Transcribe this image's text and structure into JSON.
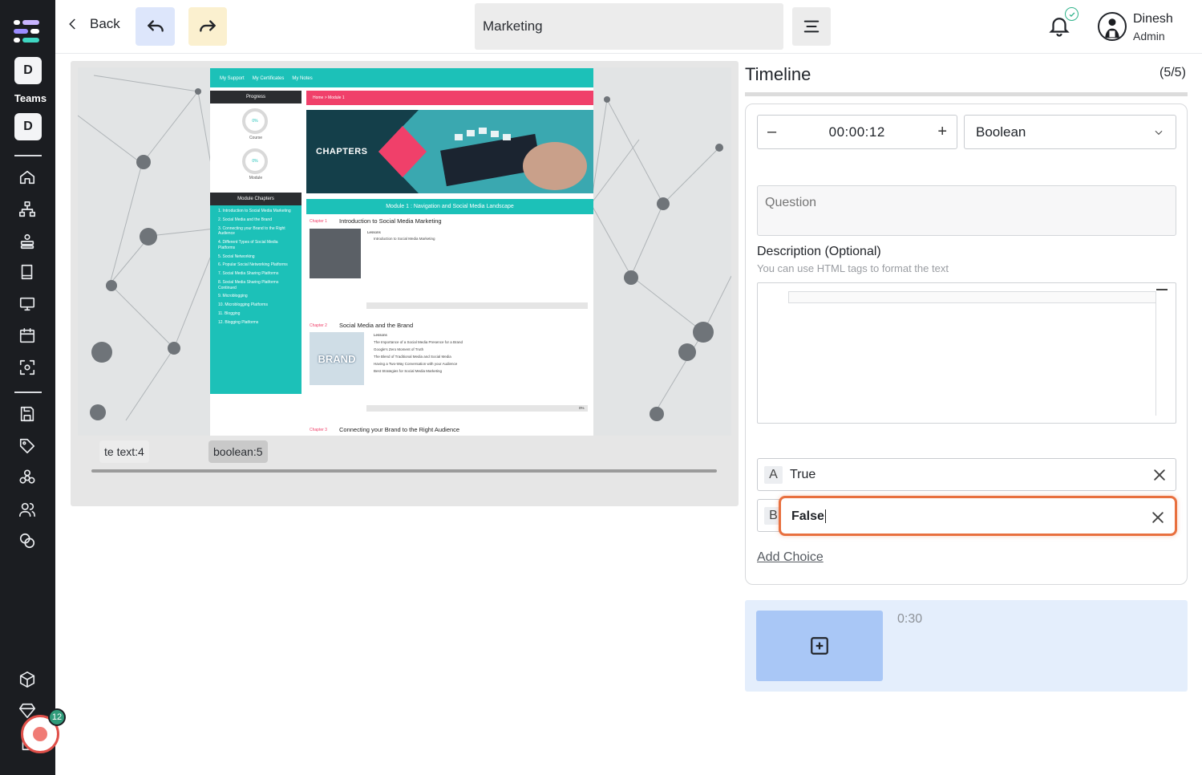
{
  "sidebar": {
    "workspace_initial": "D",
    "teams_label": "Teams",
    "team_initial": "D",
    "record_count": "12"
  },
  "topbar": {
    "back_label": "Back",
    "title_value": "Marketing",
    "user_name": "Dinesh",
    "user_role": "Admin"
  },
  "stage": {
    "tags": [
      "te text:4",
      "boolean:5"
    ]
  },
  "timeline": {
    "title": "Timeline",
    "count": "(5/5)",
    "time": "00:00:12",
    "minus": "–",
    "plus": "+",
    "type_selected": "Boolean",
    "question_placeholder": "Question",
    "description_label": "Description (Optional)",
    "description_hint": "You can use HTML tags to format the text",
    "choices": [
      {
        "letter": "A",
        "value": "True"
      },
      {
        "letter": "B",
        "value": "False"
      }
    ],
    "add_choice_label": "Add Choice",
    "duration": "0:30"
  },
  "slide": {
    "nav_links": [
      "My Support",
      "My Certificates",
      "My Notes"
    ],
    "progress_label": "Progress",
    "course_pct": "0%",
    "course_label": "Course",
    "module_pct": "0%",
    "module_label": "Module",
    "chapters_label": "Module Chapters",
    "chapter_list": [
      "1. Introduction to Social Media Marketing",
      "2. Social Media and the Brand",
      "3. Connecting your Brand to the Right Audience",
      "4. Different Types of Social Media Platforms",
      "5. Social Networking",
      "6. Popular Social Networking Platforms",
      "7. Social Media Sharing Platforms",
      "8. Social Media Sharing Platforms Continued",
      "9. Microblogging",
      "10. Microblogging Platforms",
      "11. Blogging",
      "12. Blogging Platforms"
    ],
    "breadcrumb": "Home > Module 1",
    "hero_label": "CHAPTERS",
    "module_title": "Module 1 : Navigation and Social Media Landscape",
    "chapter1_tag": "Chapter 1",
    "chapter1_title": "Introduction to Social Media Marketing",
    "chapter1_lessons_label": "Lessons",
    "chapter1_lessons": [
      "Introduction to Social Media Marketing"
    ],
    "chapter2_tag": "Chapter 2",
    "chapter2_title": "Social Media and the Brand",
    "chapter2_lessons_label": "Lessons",
    "chapter2_lessons": [
      "The Importance of a Social Media Presence for a Brand",
      "Google's Zero Moment of Truth",
      "The Blend of Traditional Media and Social Media",
      "Having a Two-Way Conversation with your Audience",
      "Best Strategies for Social Media Marketing"
    ],
    "chapter2_thumb_text": "BRAND",
    "chapter3_tag": "Chapter 3",
    "chapter3_title": "Connecting your Brand to the Right Audience",
    "progress_pct": "0%"
  },
  "colors": {
    "sidebar_bg": "#1b1d21",
    "accent_teal": "#1cc1b8",
    "accent_pink": "#f0406a",
    "focus_orange": "#e8703f",
    "panel_blue": "#e4eefc"
  }
}
